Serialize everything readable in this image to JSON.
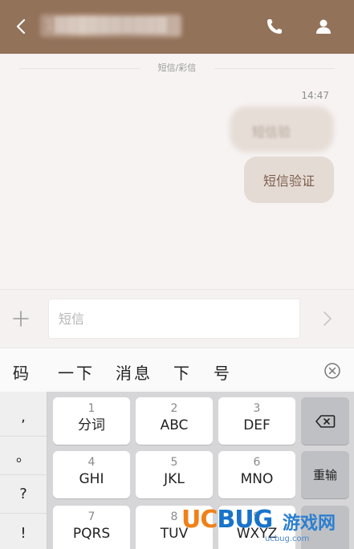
{
  "header": {
    "title": "1██████████"
  },
  "conversation": {
    "type_label": "短信/彩信",
    "time": "14:47",
    "blurred_message": "短信验",
    "message": "短信验证"
  },
  "input": {
    "placeholder": "短信"
  },
  "candidates": [
    "码",
    "一下",
    "消息",
    "下",
    "号"
  ],
  "punctuation": [
    ",",
    "。",
    "?",
    "!"
  ],
  "keys": [
    {
      "num": "1",
      "label": "分词"
    },
    {
      "num": "2",
      "label": "ABC"
    },
    {
      "num": "3",
      "label": "DEF"
    },
    {
      "num": "4",
      "label": "GHI"
    },
    {
      "num": "5",
      "label": "JKL"
    },
    {
      "num": "6",
      "label": "MNO"
    },
    {
      "num": "7",
      "label": "PQRS"
    },
    {
      "num": "8",
      "label": "TUV"
    },
    {
      "num": "9",
      "label": "WXYZ"
    }
  ],
  "function_keys": {
    "reenter": "重输"
  },
  "watermark": {
    "logo_left": "UC",
    "logo_right": "BUG",
    "cn": "游戏网",
    "domain": "ucbug.com"
  },
  "colors": {
    "header": "#93725a",
    "bubble": "#e5dbd5",
    "bubble_text": "#7a5e4c",
    "keyboard_bg": "#d6d6d8"
  },
  "icons": [
    "back-arrow-icon",
    "phone-icon",
    "contact-icon",
    "plus-icon",
    "send-arrow-icon",
    "clear-candidates-icon",
    "backspace-icon"
  ]
}
